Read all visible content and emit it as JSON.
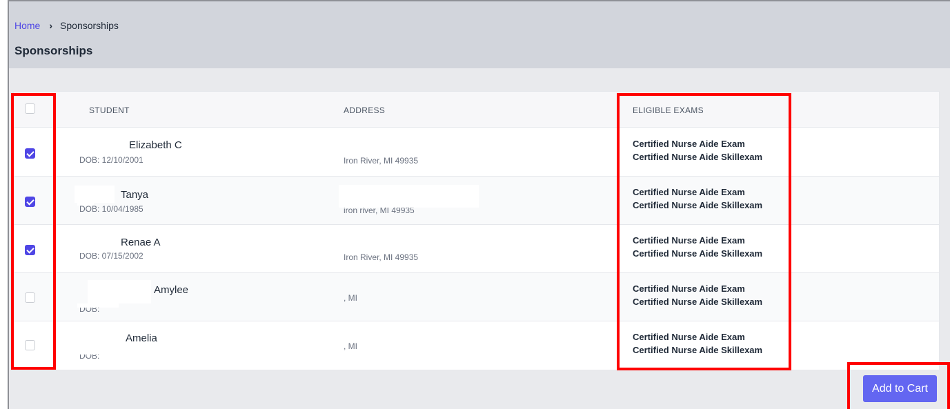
{
  "breadcrumb": {
    "home": "Home",
    "separator": "›",
    "current": "Sponsorships"
  },
  "page_title": "Sponsorships",
  "table": {
    "headers": {
      "student": "STUDENT",
      "address": "ADDRESS",
      "eligible_exams": "ELIGIBLE EXAMS"
    },
    "rows": [
      {
        "checked": true,
        "name": "Elizabeth C",
        "dob": "DOB: 12/10/2001",
        "address": "Iron River, MI 49935",
        "exam1": "Certified Nurse Aide Exam",
        "exam2": "Certified Nurse Aide Skillexam"
      },
      {
        "checked": true,
        "name": "Tanya",
        "dob": "DOB: 10/04/1985",
        "address": "iron river, MI 49935",
        "exam1": "Certified Nurse Aide Exam",
        "exam2": "Certified Nurse Aide Skillexam"
      },
      {
        "checked": true,
        "name": "Renae A",
        "dob": "DOB: 07/15/2002",
        "address": "Iron River, MI 49935",
        "exam1": "Certified Nurse Aide Exam",
        "exam2": "Certified Nurse Aide Skillexam"
      },
      {
        "checked": false,
        "name": "Amylee",
        "dob": "DOB:",
        "address": ", MI",
        "exam1": "Certified Nurse Aide Exam",
        "exam2": "Certified Nurse Aide Skillexam"
      },
      {
        "checked": false,
        "name": "Amelia",
        "dob": "DOB:",
        "address": ", MI",
        "exam1": "Certified Nurse Aide Exam",
        "exam2": "Certified Nurse Aide Skillexam"
      }
    ]
  },
  "add_to_cart_label": "Add to Cart",
  "colors": {
    "accent": "#4f46e5",
    "button": "#6366f1",
    "highlight": "#ff0000"
  }
}
